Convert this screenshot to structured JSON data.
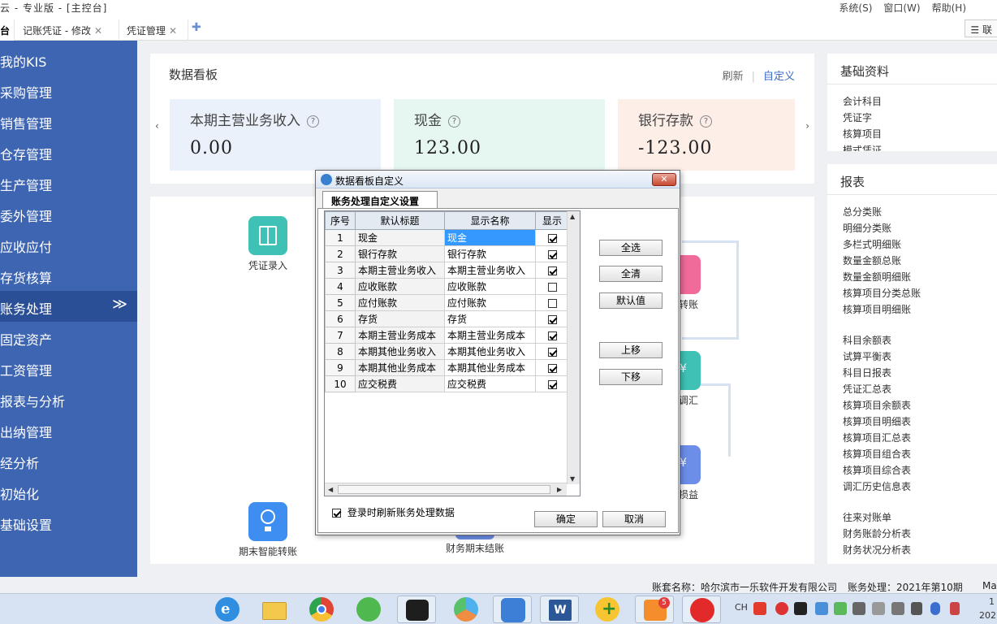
{
  "titlebar": {
    "title": "云 - 专业版 - [主控台]",
    "menus": [
      "系统(S)",
      "窗口(W)",
      "帮助(H)"
    ]
  },
  "tabs": [
    {
      "label": "台"
    },
    {
      "label": "记账凭证 - 修改"
    },
    {
      "label": "凭证管理"
    }
  ],
  "tab_add": "✚",
  "tabbar_right": "联",
  "sidebar": {
    "items": [
      {
        "label": "我的KIS"
      },
      {
        "label": "采购管理"
      },
      {
        "label": "销售管理"
      },
      {
        "label": "仓存管理"
      },
      {
        "label": "生产管理"
      },
      {
        "label": "委外管理"
      },
      {
        "label": "应收应付"
      },
      {
        "label": "存货核算"
      },
      {
        "label": "账务处理"
      },
      {
        "label": "固定资产"
      },
      {
        "label": "工资管理"
      },
      {
        "label": "报表与分析"
      },
      {
        "label": "出纳管理"
      },
      {
        "label": "经分析"
      },
      {
        "label": "初始化"
      },
      {
        "label": "基础设置"
      }
    ],
    "active_index": 8,
    "active_chevron": "≫"
  },
  "board": {
    "title": "数据看板",
    "refresh": "刷新",
    "customize": "自定义",
    "cards": [
      {
        "name": "本期主营业务收入",
        "value": "0.00",
        "color": "#eaf1fb"
      },
      {
        "name": "现金",
        "value": "123.00",
        "color": "#e6f7f1"
      },
      {
        "name": "银行存款",
        "value": "-123.00",
        "color": "#fdeee8"
      }
    ]
  },
  "flow": {
    "nodes": [
      {
        "label": "凭证录入",
        "color": "#3fc1b6"
      },
      {
        "label": "转账",
        "color": "#f06a9a"
      },
      {
        "label": "调汇",
        "color": "#3fc1b6"
      },
      {
        "label": "损益",
        "color": "#6c8ee8"
      },
      {
        "label": "期末智能转账",
        "color": "#3d8ef0"
      },
      {
        "label": "财务期末结账",
        "color": "#6c8ee8"
      }
    ]
  },
  "right_panels": {
    "basic": {
      "title": "基础资料",
      "links": [
        "会计科目",
        "凭证字",
        "核算项目",
        "模式凭证"
      ]
    },
    "reports": {
      "title": "报表",
      "groups": [
        [
          "总分类账",
          "明细分类账",
          "多栏式明细账",
          "数量金额总账",
          "数量金额明细账",
          "核算项目分类总账",
          "核算项目明细账"
        ],
        [
          "科目余额表",
          "试算平衡表",
          "科目日报表",
          "凭证汇总表",
          "核算项目余额表",
          "核算项目明细表",
          "核算项目汇总表",
          "核算项目组合表",
          "核算项目综合表",
          "调汇历史信息表"
        ],
        [
          "往来对账单",
          "财务账龄分析表",
          "财务状况分析表"
        ]
      ]
    }
  },
  "statusbar": {
    "account": "账套名称：哈尔滨市一乐软件开发有限公司",
    "period": "账务处理：2021年第10期",
    "extra": "Mar"
  },
  "dialog": {
    "title": "数据看板自定义",
    "close": "✕",
    "tab": "账务处理自定义设置",
    "columns": [
      "序号",
      "默认标题",
      "显示名称",
      "显示"
    ],
    "rows": [
      {
        "no": "1",
        "default": "现金",
        "display": "现金",
        "show": true
      },
      {
        "no": "2",
        "default": "银行存款",
        "display": "银行存款",
        "show": true
      },
      {
        "no": "3",
        "default": "本期主营业务收入",
        "display": "本期主营业务收入",
        "show": true
      },
      {
        "no": "4",
        "default": "应收账款",
        "display": "应收账款",
        "show": false
      },
      {
        "no": "5",
        "default": "应付账款",
        "display": "应付账款",
        "show": false
      },
      {
        "no": "6",
        "default": "存货",
        "display": "存货",
        "show": true
      },
      {
        "no": "7",
        "default": "本期主营业务成本",
        "display": "本期主营业务成本",
        "show": true
      },
      {
        "no": "8",
        "default": "本期其他业务收入",
        "display": "本期其他业务收入",
        "show": true
      },
      {
        "no": "9",
        "default": "本期其他业务成本",
        "display": "本期其他业务成本",
        "show": true
      },
      {
        "no": "10",
        "default": "应交税费",
        "display": "应交税费",
        "show": true
      }
    ],
    "buttons": {
      "select_all": "全选",
      "clear_all": "全清",
      "default": "默认值",
      "move_up": "上移",
      "move_down": "下移",
      "ok": "确定",
      "cancel": "取消"
    },
    "refresh_on_login": "登录时刷新账务处理数据",
    "refresh_on_login_checked": true
  },
  "taskbar": {
    "tray_lang": "CH",
    "clock_time": "1",
    "clock_year": "202"
  }
}
